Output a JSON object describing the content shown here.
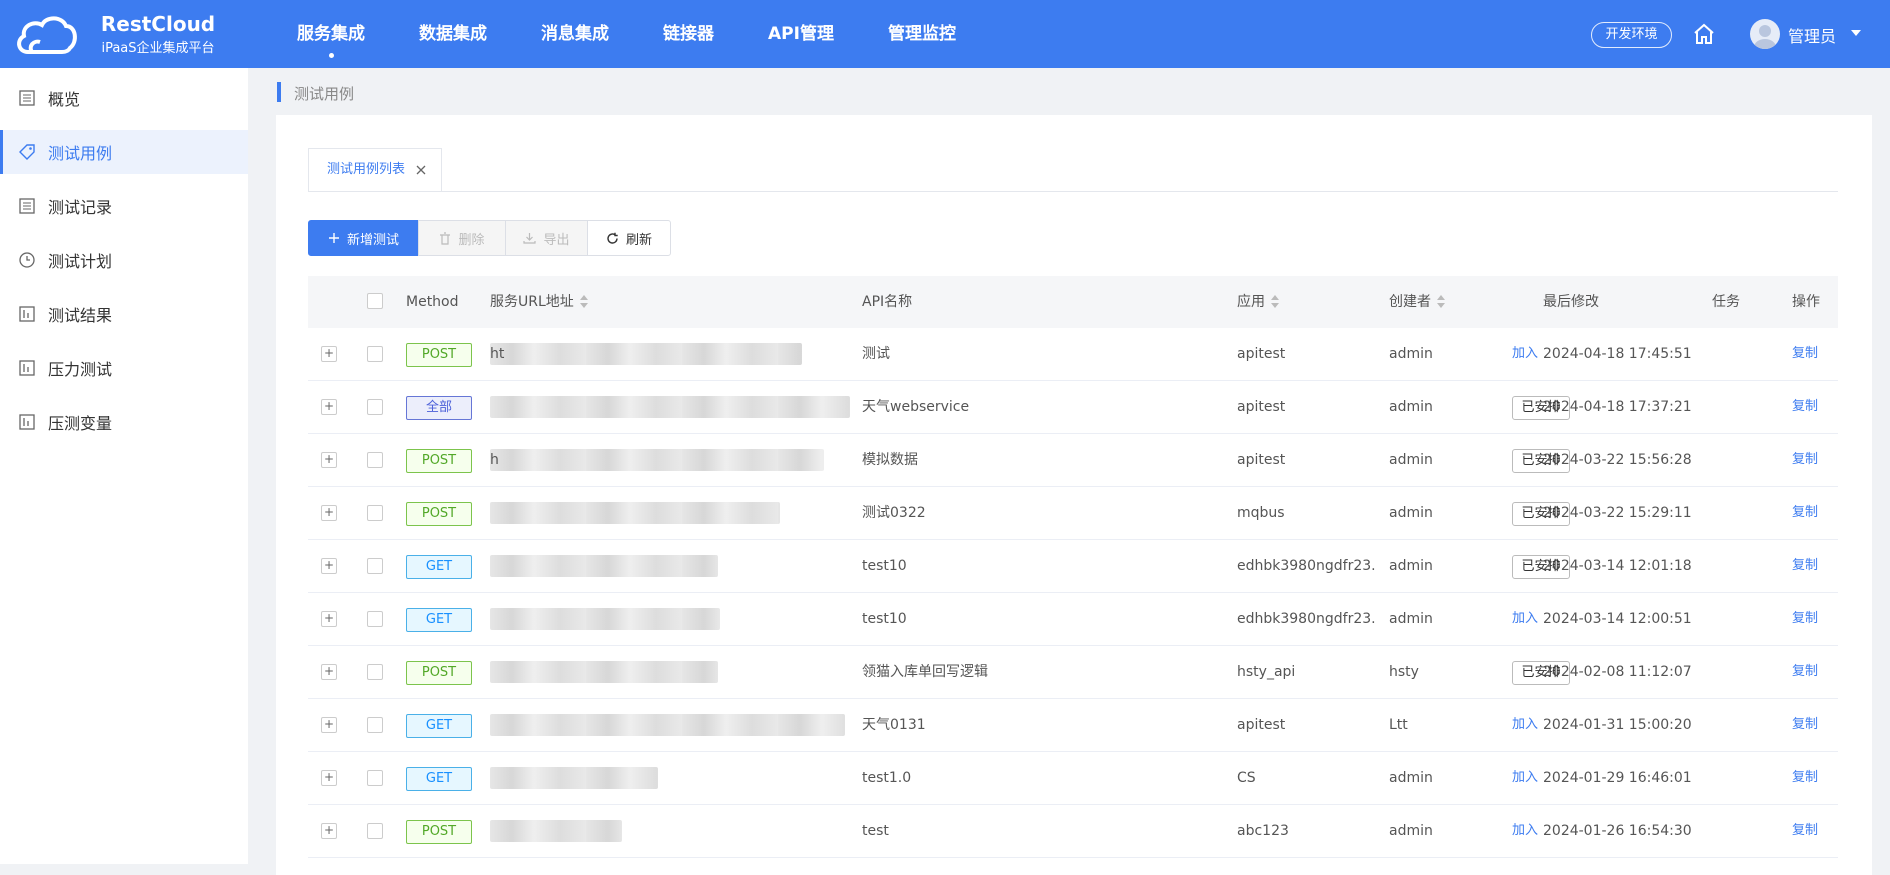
{
  "header": {
    "logo_name": "RestCloud",
    "logo_sub": "iPaaS企业集成平台",
    "nav": [
      "服务集成",
      "数据集成",
      "消息集成",
      "链接器",
      "API管理",
      "管理监控"
    ],
    "env": "开发环境",
    "user": "管理员"
  },
  "sidebar": {
    "items": [
      {
        "label": "概览",
        "icon": "list-icon"
      },
      {
        "label": "测试用例",
        "icon": "tag-icon"
      },
      {
        "label": "测试记录",
        "icon": "list-icon"
      },
      {
        "label": "测试计划",
        "icon": "clock-icon"
      },
      {
        "label": "测试结果",
        "icon": "chart-icon"
      },
      {
        "label": "压力测试",
        "icon": "chart-icon"
      },
      {
        "label": "压测变量",
        "icon": "chart-icon"
      }
    ]
  },
  "breadcrumb": "测试用例",
  "tab": {
    "label": "测试用例列表"
  },
  "toolbar": {
    "add": "新增测试",
    "delete": "删除",
    "export": "导出",
    "refresh": "刷新"
  },
  "table": {
    "headers": {
      "method": "Method",
      "url": "服务URL地址",
      "api_name": "API名称",
      "app": "应用",
      "creator": "创建者",
      "modified": "最后修改",
      "task": "任务",
      "action": "操作"
    },
    "rows": [
      {
        "method": "POST",
        "url_prefix": "ht",
        "api_name": "测试",
        "app": "apitest",
        "creator": "admin",
        "modified": "2024-04-18 17:45:51",
        "task": "加入",
        "scheduled": false,
        "action": "复制"
      },
      {
        "method": "全部",
        "url_prefix": "",
        "api_name": "天气webservice",
        "app": "apitest",
        "creator": "admin",
        "modified": "2024-04-18 17:37:21",
        "task": "已安排",
        "scheduled": true,
        "action": "复制"
      },
      {
        "method": "POST",
        "url_prefix": "h",
        "api_name": "模拟数据",
        "app": "apitest",
        "creator": "admin",
        "modified": "2024-03-22 15:56:28",
        "task": "已安排",
        "scheduled": true,
        "action": "复制"
      },
      {
        "method": "POST",
        "url_prefix": "",
        "api_name": "测试0322",
        "app": "mqbus",
        "creator": "admin",
        "modified": "2024-03-22 15:29:11",
        "task": "已安排",
        "scheduled": true,
        "action": "复制"
      },
      {
        "method": "GET",
        "url_prefix": "",
        "api_name": "test10",
        "app": "edhbk3980ngdfr23...",
        "creator": "admin",
        "modified": "2024-03-14 12:01:18",
        "task": "已安排",
        "scheduled": true,
        "action": "复制"
      },
      {
        "method": "GET",
        "url_prefix": "",
        "api_name": "test10",
        "app": "edhbk3980ngdfr23...",
        "creator": "admin",
        "modified": "2024-03-14 12:00:51",
        "task": "加入",
        "scheduled": false,
        "action": "复制"
      },
      {
        "method": "POST",
        "url_prefix": "",
        "api_name": "领猫入库单回写逻辑",
        "app": "hsty_api",
        "creator": "hsty",
        "modified": "2024-02-08 11:12:07",
        "task": "已安排",
        "scheduled": true,
        "action": "复制"
      },
      {
        "method": "GET",
        "url_prefix": "",
        "api_name": "天气0131",
        "app": "apitest",
        "creator": "Ltt",
        "modified": "2024-01-31 15:00:20",
        "task": "加入",
        "scheduled": false,
        "action": "复制"
      },
      {
        "method": "GET",
        "url_prefix": "",
        "api_name": "test1.0",
        "app": "CS",
        "creator": "admin",
        "modified": "2024-01-29 16:46:01",
        "task": "加入",
        "scheduled": false,
        "action": "复制"
      },
      {
        "method": "POST",
        "url_prefix": "",
        "api_name": "test",
        "app": "abc123",
        "creator": "admin",
        "modified": "2024-01-26 16:54:30",
        "task": "加入",
        "scheduled": false,
        "action": "复制"
      }
    ]
  },
  "colors": {
    "brand": "#3d7cf0",
    "post": "#52a828",
    "get": "#1890ff",
    "all": "#4c60d9"
  }
}
